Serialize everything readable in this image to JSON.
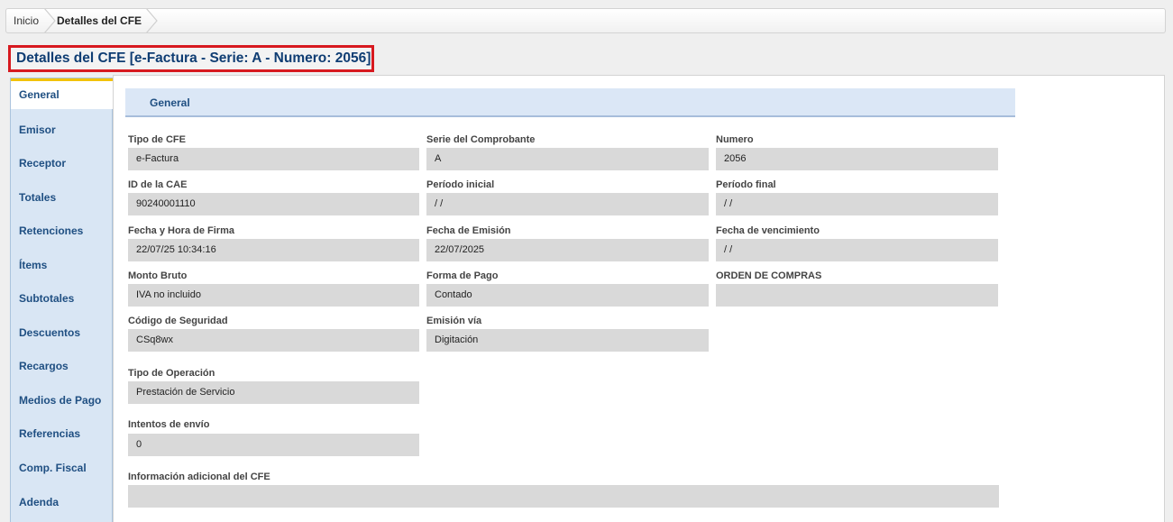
{
  "breadcrumb": {
    "home": "Inicio",
    "current": "Detalles del CFE"
  },
  "page_title": "Detalles del CFE [e-Factura - Serie: A - Numero: 2056]",
  "tabs": [
    {
      "label": "General",
      "active": true
    },
    {
      "label": "Emisor"
    },
    {
      "label": "Receptor"
    },
    {
      "label": "Totales"
    },
    {
      "label": "Retenciones"
    },
    {
      "label": "Ítems"
    },
    {
      "label": "Subtotales"
    },
    {
      "label": "Descuentos"
    },
    {
      "label": "Recargos"
    },
    {
      "label": "Medios de Pago"
    },
    {
      "label": "Referencias"
    },
    {
      "label": "Comp. Fiscal"
    },
    {
      "label": "Adenda"
    }
  ],
  "section": {
    "title": "General",
    "fields": {
      "tipo_cfe": {
        "label": "Tipo de CFE",
        "value": "e-Factura"
      },
      "serie": {
        "label": "Serie del Comprobante",
        "value": "A"
      },
      "numero": {
        "label": "Numero",
        "value": "2056"
      },
      "id_cae": {
        "label": "ID de la CAE",
        "value": "90240001110"
      },
      "periodo_inicial": {
        "label": "Período inicial",
        "value": "/ /"
      },
      "periodo_final": {
        "label": "Período final",
        "value": "/ /"
      },
      "fecha_firma": {
        "label": "Fecha y Hora de Firma",
        "value": "22/07/25 10:34:16"
      },
      "fecha_emision": {
        "label": "Fecha de Emisión",
        "value": "22/07/2025"
      },
      "fecha_vencimiento": {
        "label": "Fecha de vencimiento",
        "value": "/ /"
      },
      "monto_bruto": {
        "label": "Monto Bruto",
        "value": "IVA no incluido"
      },
      "forma_pago": {
        "label": "Forma de Pago",
        "value": "Contado"
      },
      "orden_compras": {
        "label": "ORDEN DE COMPRAS",
        "value": ""
      },
      "codigo_seguridad": {
        "label": "Código de Seguridad",
        "value": "CSq8wx"
      },
      "emision_via": {
        "label": "Emisión vía",
        "value": "Digitación"
      },
      "tipo_operacion": {
        "label": "Tipo de Operación",
        "value": "Prestación de Servicio"
      },
      "intentos_envio": {
        "label": "Intentos de envío",
        "value": "0"
      },
      "info_adicional": {
        "label": "Información adicional del CFE",
        "value": ""
      }
    }
  }
}
